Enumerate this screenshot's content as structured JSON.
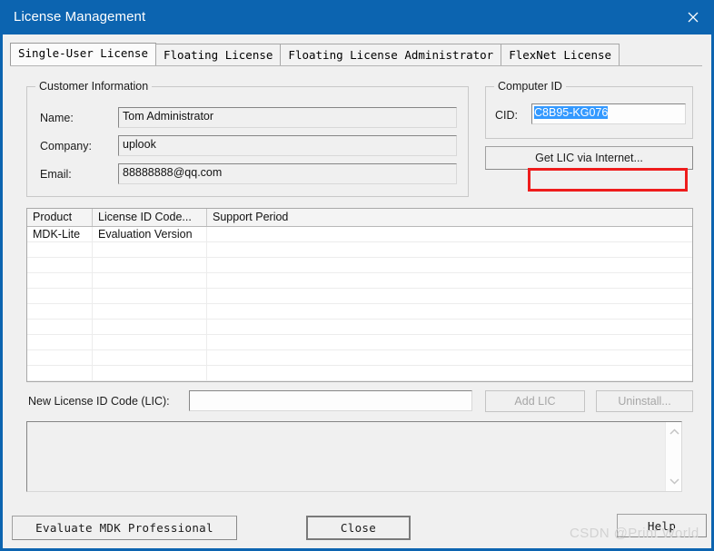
{
  "window": {
    "title": "License Management",
    "close_icon": "close-icon"
  },
  "tabs": [
    {
      "label": "Single-User License",
      "selected": true
    },
    {
      "label": "Floating License",
      "selected": false
    },
    {
      "label": "Floating License Administrator",
      "selected": false
    },
    {
      "label": "FlexNet License",
      "selected": false
    }
  ],
  "customer_information": {
    "group_title": "Customer Information",
    "name_label": "Name:",
    "name_value": "Tom Administrator",
    "company_label": "Company:",
    "company_value": "uplook",
    "email_label": "Email:",
    "email_value": "88888888@qq.com"
  },
  "computer_id": {
    "group_title": "Computer ID",
    "cid_label": "CID:",
    "cid_value": "C8B95-KG076",
    "cid_selected": true,
    "get_lic_button": "Get LIC via Internet...",
    "annotation_color": "#ee1c1c"
  },
  "license_table": {
    "columns": [
      "Product",
      "License ID Code...",
      "Support Period"
    ],
    "rows": [
      [
        "MDK-Lite",
        "Evaluation Version",
        ""
      ]
    ],
    "empty_row_count": 10
  },
  "new_license": {
    "label": "New License ID Code (LIC):",
    "value": "",
    "placeholder": "",
    "add_button": "Add LIC",
    "add_button_disabled": true,
    "uninstall_button": "Uninstall...",
    "uninstall_button_disabled": true
  },
  "message_box": {
    "value": "",
    "scroll_up_icon": "chevron-up-icon",
    "scroll_down_icon": "chevron-down-icon"
  },
  "footer": {
    "evaluate_button": "Evaluate MDK Professional",
    "close_button": "Close",
    "help_button": "Help"
  },
  "watermark": {
    "text": "CSDN @Print World"
  }
}
